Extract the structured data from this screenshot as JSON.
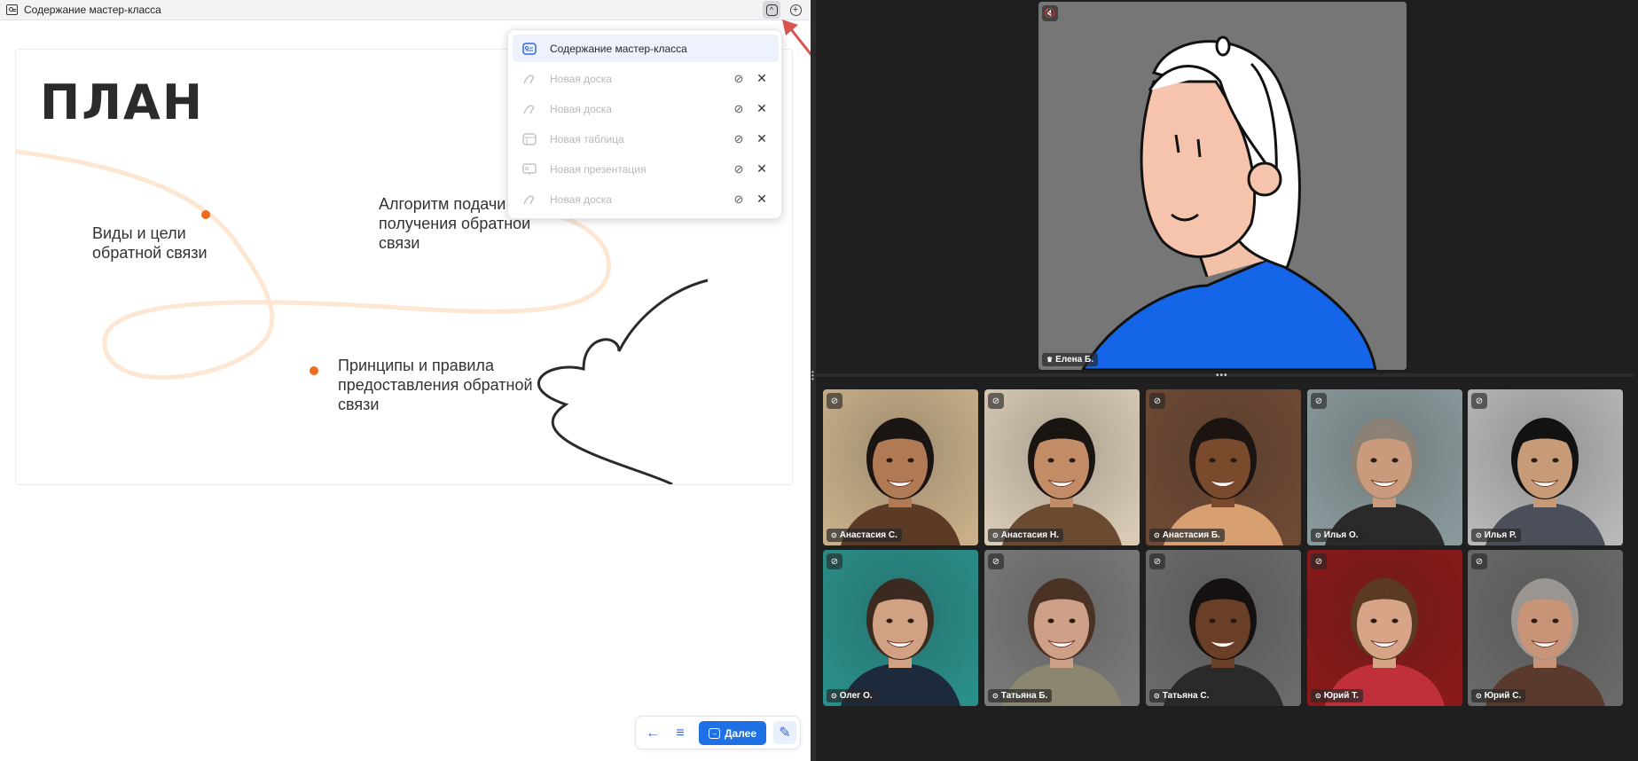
{
  "window": {
    "title": "Содержание мастер-класса"
  },
  "slide": {
    "title": "ПЛАН",
    "items": [
      "Виды и цели обратной связи",
      "Алгоритм подачи и получения обратной связи",
      "Принципы и правила предоставления обратной связи"
    ],
    "accent": "#f26b1d"
  },
  "dropdown": {
    "items": [
      {
        "label": "Содержание мастер-класса",
        "icon": "presentation-active-icon",
        "active": true
      },
      {
        "label": "Новая доска",
        "icon": "whiteboard-icon",
        "active": false
      },
      {
        "label": "Новая доска",
        "icon": "whiteboard-icon",
        "active": false
      },
      {
        "label": "Новая таблица",
        "icon": "table-icon",
        "active": false
      },
      {
        "label": "Новая презентация",
        "icon": "presentation-icon",
        "active": false
      },
      {
        "label": "Новая доска",
        "icon": "whiteboard-icon",
        "active": false
      }
    ]
  },
  "controls": {
    "next_label": "Далее"
  },
  "speaker": {
    "name": "Елена Б.",
    "bg": "#767676"
  },
  "participants": [
    {
      "name": "Анастасия С.",
      "bg": "#c9b08a",
      "skin": "#b07a55",
      "hair": "#1a1412",
      "shirt": "#5b3a26"
    },
    {
      "name": "Анастасия Н.",
      "bg": "#d9cbb6",
      "skin": "#c28c66",
      "hair": "#1b1512",
      "shirt": "#6b4a32"
    },
    {
      "name": "Анастасия Б.",
      "bg": "#6e4a34",
      "skin": "#7a4a2c",
      "hair": "#1c1410",
      "shirt": "#d8a070"
    },
    {
      "name": "Илья О.",
      "bg": "#8a9a9c",
      "skin": "#c99a7c",
      "hair": "#8b8174",
      "shirt": "#2a2a2a"
    },
    {
      "name": "Илья Р.",
      "bg": "#b8b8b8",
      "skin": "#c79b78",
      "hair": "#121212",
      "shirt": "#4a4f5a"
    },
    {
      "name": "Олег О.",
      "bg": "#2a8f8a",
      "skin": "#d1a184",
      "hair": "#3a2a1f",
      "shirt": "#1d2a3c"
    },
    {
      "name": "Татьяна Б.",
      "bg": "#7a7a7a",
      "skin": "#cfa088",
      "hair": "#4a3224",
      "shirt": "#8a8670"
    },
    {
      "name": "Татьяна С.",
      "bg": "#6b6b6b",
      "skin": "#6a3f28",
      "hair": "#151110",
      "shirt": "#2a2a2a"
    },
    {
      "name": "Юрий Т.",
      "bg": "#8a1a1a",
      "skin": "#d7a487",
      "hair": "#5a3a22",
      "shirt": "#c0303a"
    },
    {
      "name": "Юрий С.",
      "bg": "#6a6a6a",
      "skin": "#c89478",
      "hair": "#9a9590",
      "shirt": "#5a3a2c"
    }
  ]
}
